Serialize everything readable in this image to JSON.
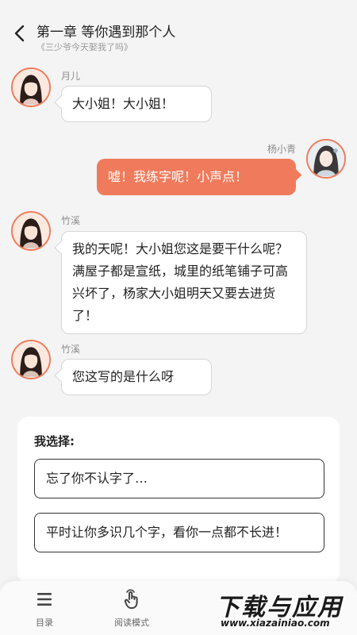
{
  "header": {
    "chapter_title": "第一章 等你遇到那个人",
    "book_title": "《三少爷今天娶我了吗》"
  },
  "messages": [
    {
      "speaker": "月儿",
      "text": "大小姐！大小姐！",
      "side": "left"
    },
    {
      "speaker": "杨小青",
      "text": "嘘！我练字呢！小声点！",
      "side": "right"
    },
    {
      "speaker": "竹溪",
      "text": "我的天呢！大小姐您这是要干什么呢？满屋子都是宣纸，城里的纸笔铺子可高兴坏了，杨家大小姐明天又要去进货了！",
      "side": "left"
    },
    {
      "speaker": "竹溪",
      "text": "您这写的是什么呀",
      "side": "left"
    }
  ],
  "choices": {
    "heading": "我选择:",
    "options": [
      "忘了你不认字了…",
      "平时让你多识几个字，看你一点都不长进！"
    ]
  },
  "bottom_nav": {
    "items": [
      {
        "label": "目录",
        "icon": "menu-icon"
      },
      {
        "label": "阅读模式",
        "icon": "tap-hand-icon"
      }
    ]
  },
  "colors": {
    "accent": "#f07b5c",
    "background": "#f4f4f4"
  }
}
